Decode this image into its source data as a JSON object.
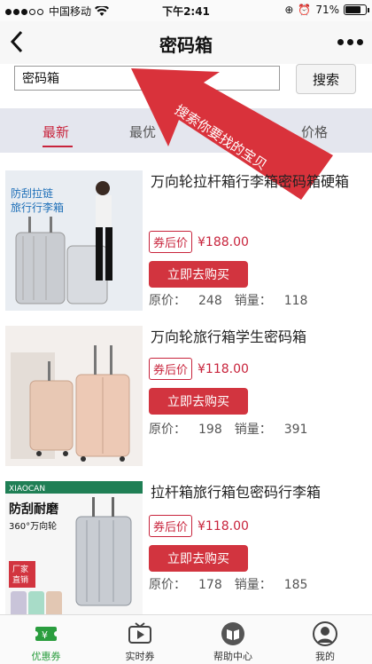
{
  "status_bar": {
    "carrier": "中国移动",
    "time": "下午2:41",
    "battery": "71%"
  },
  "nav": {
    "title": "密码箱"
  },
  "search": {
    "value": "密码箱",
    "button": "搜索"
  },
  "annotation": {
    "text": "搜索你要找的宝贝"
  },
  "tabs": [
    {
      "label": "最新",
      "active": true
    },
    {
      "label": "最优",
      "active": false
    },
    {
      "label": "价格",
      "active": false
    }
  ],
  "products": [
    {
      "title": "万向轮拉杆箱行李箱密码箱硬箱",
      "image_text_1": "防刮拉链",
      "image_text_2": "旅行行李箱",
      "coupon_label": "券后价",
      "coupon_price": "¥188.00",
      "buy_label": "立即去购买",
      "original_label": "原价：",
      "original_price": "248",
      "sales_label": "销量：",
      "sales": "118"
    },
    {
      "title": "万向轮旅行箱学生密码箱",
      "coupon_label": "券后价",
      "coupon_price": "¥118.00",
      "buy_label": "立即去购买",
      "original_label": "原价：",
      "original_price": "198",
      "sales_label": "销量：",
      "sales": "391"
    },
    {
      "title": "拉杆箱旅行箱包密码行李箱",
      "image_brand": "XIAOCAN",
      "image_text_1": "防刮耐磨",
      "image_text_2": "360°万向轮",
      "image_badge_1": "厂家",
      "image_badge_2": "直销",
      "coupon_label": "券后价",
      "coupon_price": "¥118.00",
      "buy_label": "立即去购买",
      "original_label": "原价：",
      "original_price": "178",
      "sales_label": "销量：",
      "sales": "185"
    }
  ],
  "tabbar": [
    {
      "label": "优惠券",
      "icon": "ticket-icon",
      "active": true
    },
    {
      "label": "实时券",
      "icon": "video-icon",
      "active": false
    },
    {
      "label": "帮助中心",
      "icon": "book-icon",
      "active": false
    },
    {
      "label": "我的",
      "icon": "user-icon",
      "active": false
    }
  ],
  "colors": {
    "accent": "#c8243c",
    "buy_button": "#d2343f",
    "tab_background": "#e4e6ee",
    "tabbar_active": "#2a9d3e"
  }
}
